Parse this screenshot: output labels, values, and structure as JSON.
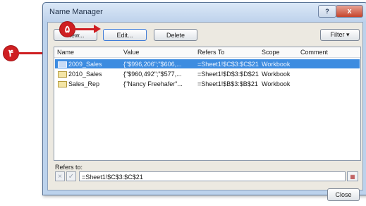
{
  "window": {
    "title": "Name Manager",
    "help_label": "?",
    "close_label": "x"
  },
  "toolbar": {
    "new_label": "New...",
    "edit_label": "Edit...",
    "delete_label": "Delete",
    "filter_label": "Filter ▾"
  },
  "columns": [
    "Name",
    "Value",
    "Refers To",
    "Scope",
    "Comment"
  ],
  "rows": [
    {
      "name": "2009_Sales",
      "value": "{\"$996,206\";\"$606,...",
      "refers_to": "=Sheet1!$C$3:$C$21",
      "scope": "Workbook",
      "comment": "",
      "selected": true
    },
    {
      "name": "2010_Sales",
      "value": "{\"$960,492\";\"$577,...",
      "refers_to": "=Sheet1!$D$3:$D$21",
      "scope": "Workbook",
      "comment": "",
      "selected": false
    },
    {
      "name": "Sales_Rep",
      "value": "{\"Nancy Freehafer\"...",
      "refers_to": "=Sheet1!$B$3:$B$21",
      "scope": "Workbook",
      "comment": "",
      "selected": false
    }
  ],
  "refers_to": {
    "label": "Refers to:",
    "value": "=Sheet1!$C$3:$C$21",
    "cancel_icon": "×",
    "ok_icon": "✓"
  },
  "footer": {
    "close_label": "Close"
  },
  "annotations": {
    "step4": "۴",
    "step5": "۵",
    "color": "#cf1f22"
  }
}
